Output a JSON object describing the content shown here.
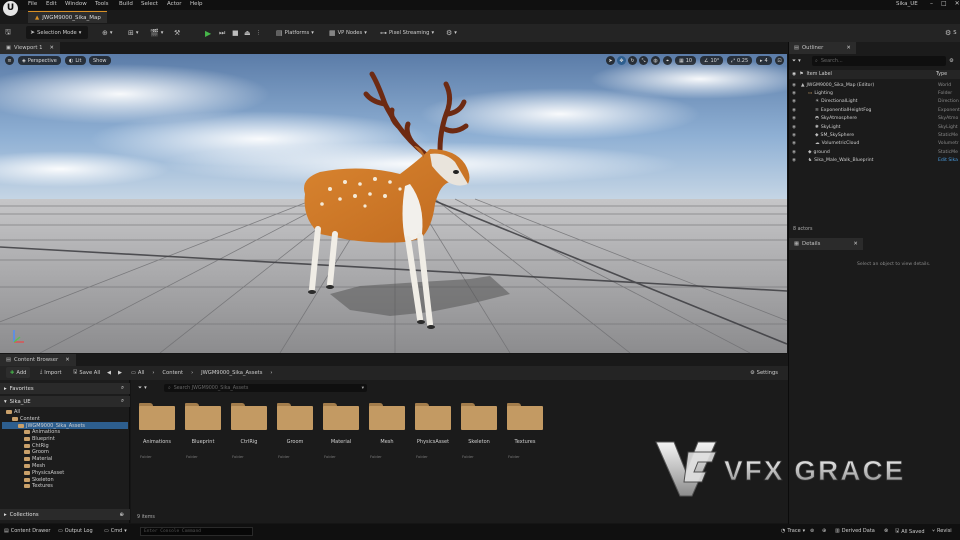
{
  "app": {
    "logo": "U",
    "project_name": "Sika_UE"
  },
  "menu": [
    "File",
    "Edit",
    "Window",
    "Tools",
    "Build",
    "Select",
    "Actor",
    "Help"
  ],
  "level_tab": "JWGM9000_Sika_Map",
  "toolbar": {
    "selection_mode": "Selection Mode",
    "platforms": "Platforms",
    "vp_nodes": "VP Nodes",
    "pixel_streaming": "Pixel Streaming"
  },
  "viewport": {
    "tab": "Viewport 1",
    "perspective": "Perspective",
    "lit": "Lit",
    "show": "Show",
    "grid_snap": "10",
    "rot_snap": "10°",
    "scale_snap": "0.25",
    "cam_speed": "4"
  },
  "content_browser": {
    "tab": "Content Browser",
    "add": "Add",
    "import": "Import",
    "save_all": "Save All",
    "breadcrumb": [
      "All",
      "Content",
      "JWGM9000_Sika_Assets"
    ],
    "settings": "Settings",
    "search_placeholder": "Search JWGM9000_Sika_Assets",
    "favorites": "Favorites",
    "root": "Sika_UE",
    "collections": "Collections",
    "tree": {
      "all": "All",
      "content": "Content",
      "assets_folder": "JWGM9000_Sika_Assets",
      "children": [
        "Animations",
        "Blueprint",
        "ChtRig",
        "Groom",
        "Material",
        "Mesh",
        "PhysicsAsset",
        "Skeleton",
        "Textures"
      ]
    },
    "folders": [
      {
        "name": "Animations",
        "type": "Folder"
      },
      {
        "name": "Blueprint",
        "type": "Folder"
      },
      {
        "name": "CtrlRig",
        "type": "Folder"
      },
      {
        "name": "Groom",
        "type": "Folder"
      },
      {
        "name": "Material",
        "type": "Folder"
      },
      {
        "name": "Mesh",
        "type": "Folder"
      },
      {
        "name": "PhysicsAsset",
        "type": "Folder"
      },
      {
        "name": "Skeleton",
        "type": "Folder"
      },
      {
        "name": "Textures",
        "type": "Folder"
      }
    ],
    "items_count": "9 items"
  },
  "outliner": {
    "tab": "Outliner",
    "search_placeholder": "Search...",
    "col_label": "Item Label",
    "col_type": "Type",
    "rows": [
      {
        "label": "JWGM9000_Sika_Map (Editor)",
        "type": "World",
        "indent": 0,
        "icon": "world-icon"
      },
      {
        "label": "Lighting",
        "type": "Folder",
        "indent": 1,
        "icon": "folder-icon"
      },
      {
        "label": "DirectionalLight",
        "type": "Direction",
        "indent": 2,
        "icon": "light-icon"
      },
      {
        "label": "ExponentialHeightFog",
        "type": "Exponent",
        "indent": 2,
        "icon": "fog-icon"
      },
      {
        "label": "SkyAtmosphere",
        "type": "SkyAtmo",
        "indent": 2,
        "icon": "atmosphere-icon"
      },
      {
        "label": "SkyLight",
        "type": "SkyLight",
        "indent": 2,
        "icon": "skylight-icon"
      },
      {
        "label": "SM_SkySphere",
        "type": "StaticMe",
        "indent": 2,
        "icon": "mesh-icon"
      },
      {
        "label": "VolumetricCloud",
        "type": "Volumetr",
        "indent": 2,
        "icon": "cloud-icon"
      },
      {
        "label": "ground",
        "type": "StaticMe",
        "indent": 1,
        "icon": "mesh-icon"
      },
      {
        "label": "Sika_Male_Walk_Blueprint",
        "type": "Edit Sika",
        "indent": 1,
        "icon": "actor-icon"
      }
    ],
    "actors_count": "8 actors"
  },
  "details": {
    "tab": "Details",
    "empty_text": "Select an object to view details."
  },
  "status": {
    "content_drawer": "Content Drawer",
    "output_log": "Output Log",
    "cmd": "Cmd",
    "console_placeholder": "Enter Console Command",
    "trace": "Trace",
    "derived_data": "Derived Data",
    "all_saved": "All Saved",
    "revision": "Revisi"
  },
  "watermark": {
    "text": "VFX GRACE"
  },
  "colors": {
    "accent_orange": "#d89026",
    "play_green": "#46b64a",
    "folder": "#c39a63",
    "selection_blue": "#2d5e8e"
  }
}
